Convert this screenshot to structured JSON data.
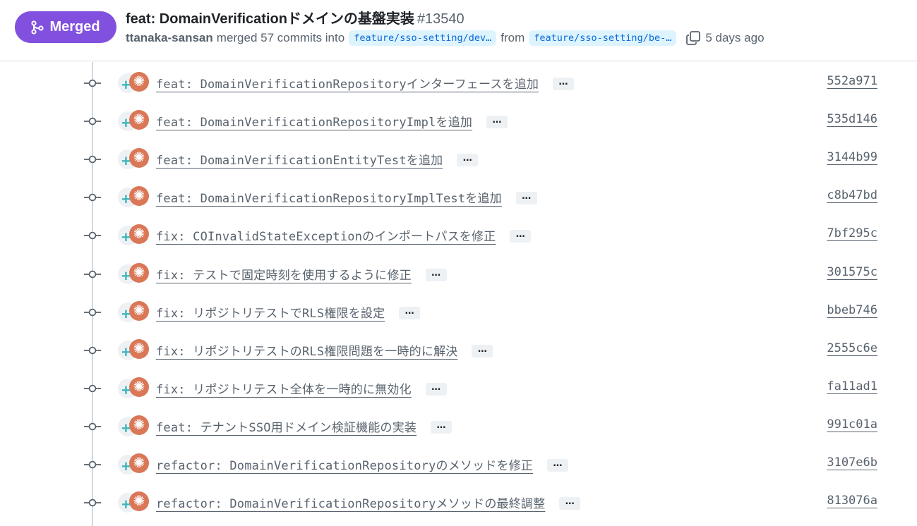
{
  "header": {
    "status_label": "Merged",
    "title": "feat: DomainVerificationドメインの基盤実装",
    "number": "#13540",
    "author": "ttanaka-sansan",
    "merge_text": "merged 57 commits into",
    "base_branch": "feature/sso-setting/dev…",
    "from_text": "from",
    "head_branch": "feature/sso-setting/be-…",
    "time_ago": "5 days ago"
  },
  "colors": {
    "merged": "#8250df",
    "branch_bg": "#ddf4ff",
    "branch_text": "#0969da",
    "claude_avatar": "#d97757",
    "bot_plus": "#3fb6bd"
  },
  "icons": {
    "status": "git-merge-icon",
    "copy": "copy-icon",
    "commit": "git-commit-icon",
    "bot_avatar": "plus-icon",
    "claude_avatar": "sparkle-icon"
  },
  "commits": [
    {
      "message": "feat: DomainVerificationRepositoryインターフェースを追加",
      "sha": "552a971",
      "more": "…"
    },
    {
      "message": "feat: DomainVerificationRepositoryImplを追加",
      "sha": "535d146",
      "more": "…"
    },
    {
      "message": "feat: DomainVerificationEntityTestを追加",
      "sha": "3144b99",
      "more": "…"
    },
    {
      "message": "feat: DomainVerificationRepositoryImplTestを追加",
      "sha": "c8b47bd",
      "more": "…"
    },
    {
      "message": "fix: COInvalidStateExceptionのインポートパスを修正",
      "sha": "7bf295c",
      "more": "…"
    },
    {
      "message": "fix: テストで固定時刻を使用するように修正",
      "sha": "301575c",
      "more": "…"
    },
    {
      "message": "fix: リポジトリテストでRLS権限を設定",
      "sha": "bbeb746",
      "more": "…"
    },
    {
      "message": "fix: リポジトリテストのRLS権限問題を一時的に解決",
      "sha": "2555c6e",
      "more": "…"
    },
    {
      "message": "fix: リポジトリテスト全体を一時的に無効化",
      "sha": "fa11ad1",
      "more": "…"
    },
    {
      "message": "feat: テナントSSO用ドメイン検証機能の実装",
      "sha": "991c01a",
      "more": "…"
    },
    {
      "message": "refactor: DomainVerificationRepositoryのメソッドを修正",
      "sha": "3107e6b",
      "more": "…"
    },
    {
      "message": "refactor: DomainVerificationRepositoryメソッドの最終調整",
      "sha": "813076a",
      "more": "…"
    }
  ]
}
